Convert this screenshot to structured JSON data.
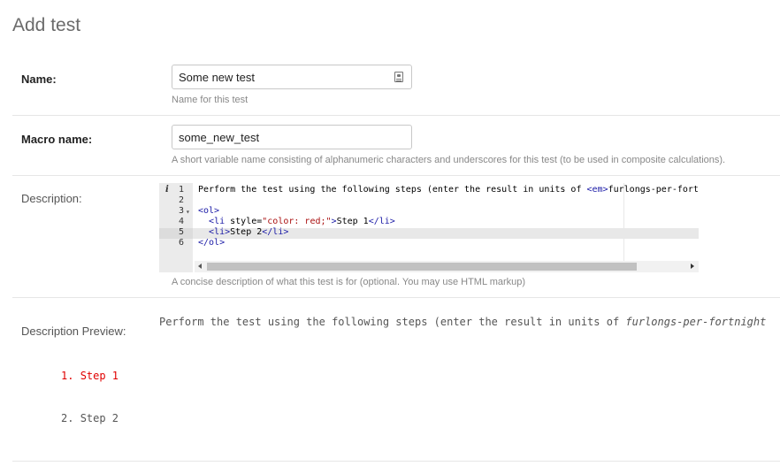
{
  "page": {
    "title": "Add test"
  },
  "name_field": {
    "label": "Name:",
    "value": "Some new test",
    "help": "Name for this test",
    "icon": "contact-card-icon"
  },
  "macro_field": {
    "label": "Macro name:",
    "value": "some_new_test",
    "help": "A short variable name consisting of alphanumeric characters and underscores for this test (to be used in composite calculations)."
  },
  "description": {
    "label": "Description:",
    "help": "A concise description of what this test is for (optional. You may use HTML markup)",
    "line_numbers": [
      "1",
      "2",
      "3",
      "4",
      "5",
      "6"
    ],
    "info_marker": "i",
    "code": {
      "line1_text": "Perform the test using the following steps (enter the result in units of ",
      "line1_tag": "<em>",
      "line1_rest": "furlongs-per-fortn",
      "ol_open": "<ol>",
      "li_open": "<li",
      "style_attr": " style=",
      "style_value": "\"color: red;\"",
      "tag_close": ">",
      "step1": "Step 1",
      "li_close": "</li>",
      "li_plain": "<li>",
      "step2": "Step 2",
      "ol_close": "</ol>"
    }
  },
  "preview": {
    "label": "Description Preview:",
    "text": "Perform the test using the following steps (enter the result in units of ",
    "em_text": "furlongs-per-fortnight",
    "steps": [
      {
        "number": "1.",
        "text": "Step 1",
        "color": "#e00000"
      },
      {
        "number": "2.",
        "text": "Step 2",
        "color": "#555555"
      }
    ]
  }
}
